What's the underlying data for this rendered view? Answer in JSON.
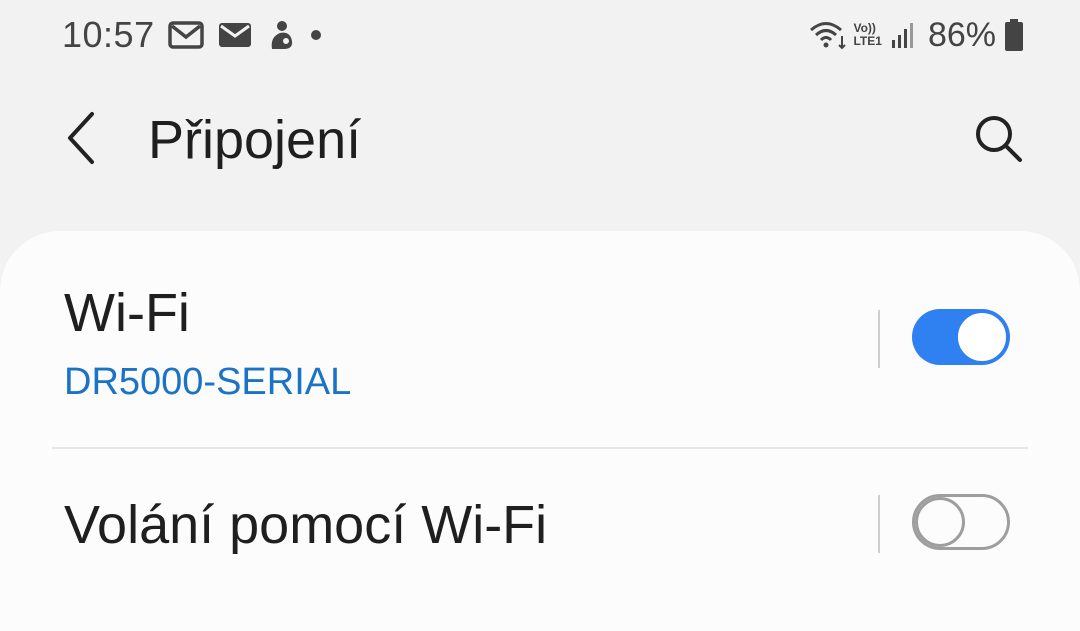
{
  "status_bar": {
    "time": "10:57",
    "notification_icons": [
      "gmail-icon",
      "email-icon",
      "app-notification-icon",
      "more-notifications-dot-icon"
    ],
    "volte_top": "Vo))",
    "volte_bottom": "LTE1",
    "battery_percent": "86%",
    "status_icons": [
      "wifi-icon",
      "volte-lte-icon",
      "signal-icon",
      "battery-icon"
    ]
  },
  "app_bar": {
    "title": "Připojení",
    "back_icon": "chevron-left-icon",
    "search_icon": "search-icon"
  },
  "settings": [
    {
      "title": "Wi-Fi",
      "subtitle": "DR5000-SERIAL",
      "toggle_on": true
    },
    {
      "title": "Volání pomocí Wi-Fi",
      "subtitle": "",
      "toggle_on": false
    }
  ],
  "colors": {
    "accent": "#2f80f0",
    "subtitle": "#1a73c5",
    "background": "#f2f2f2",
    "card": "#fcfcfc"
  }
}
